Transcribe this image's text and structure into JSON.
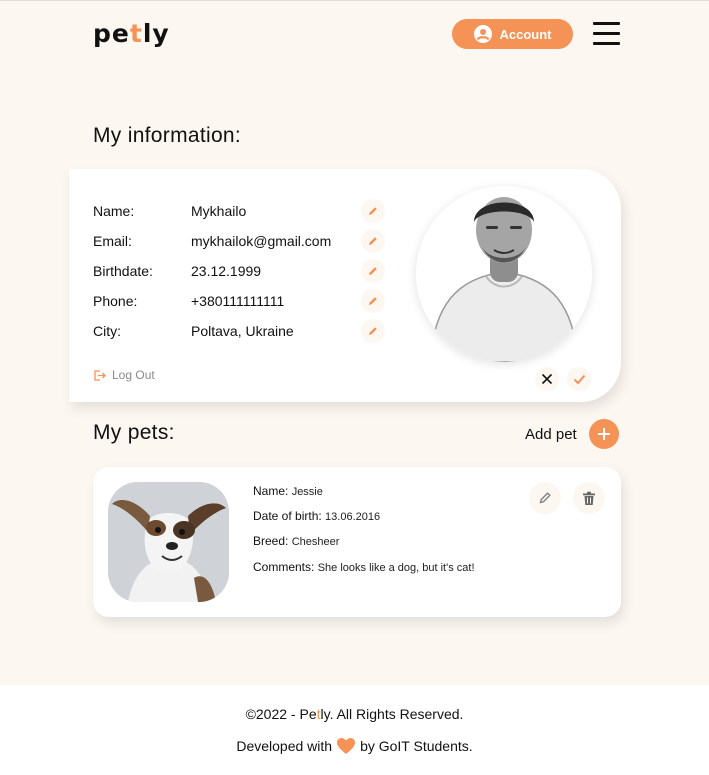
{
  "header": {
    "logo_part1": "pe",
    "logo_accent": "t",
    "logo_part2": "ly",
    "account_label": "Account"
  },
  "info": {
    "title": "My information:",
    "fields": [
      {
        "label": "Name:",
        "value": "Mykhailo"
      },
      {
        "label": "Email:",
        "value": "mykhailok@gmail.com"
      },
      {
        "label": "Birthdate:",
        "value": "23.12.1999"
      },
      {
        "label": "Phone:",
        "value": "+380111111111"
      },
      {
        "label": "City:",
        "value": "Poltava, Ukraine"
      }
    ],
    "logout_label": "Log Out"
  },
  "pets": {
    "title": "My pets:",
    "add_label": "Add pet",
    "items": [
      {
        "name_label": "Name:",
        "name": "Jessie",
        "dob_label": "Date of birth:",
        "dob": "13.06.2016",
        "breed_label": "Breed:",
        "breed": "Chesheer",
        "comments_label": "Comments:",
        "comments": "She looks like a dog, but it's cat!"
      }
    ]
  },
  "footer": {
    "copy_part1": "©2022 - Pe",
    "copy_accent": "t",
    "copy_part2": "ly. All Rights Reserved.",
    "dev_part1": "Developed with",
    "dev_part2": "by GoIT Students."
  },
  "colors": {
    "accent": "#f59256",
    "background": "#fdf7f2",
    "card": "#ffffff"
  }
}
